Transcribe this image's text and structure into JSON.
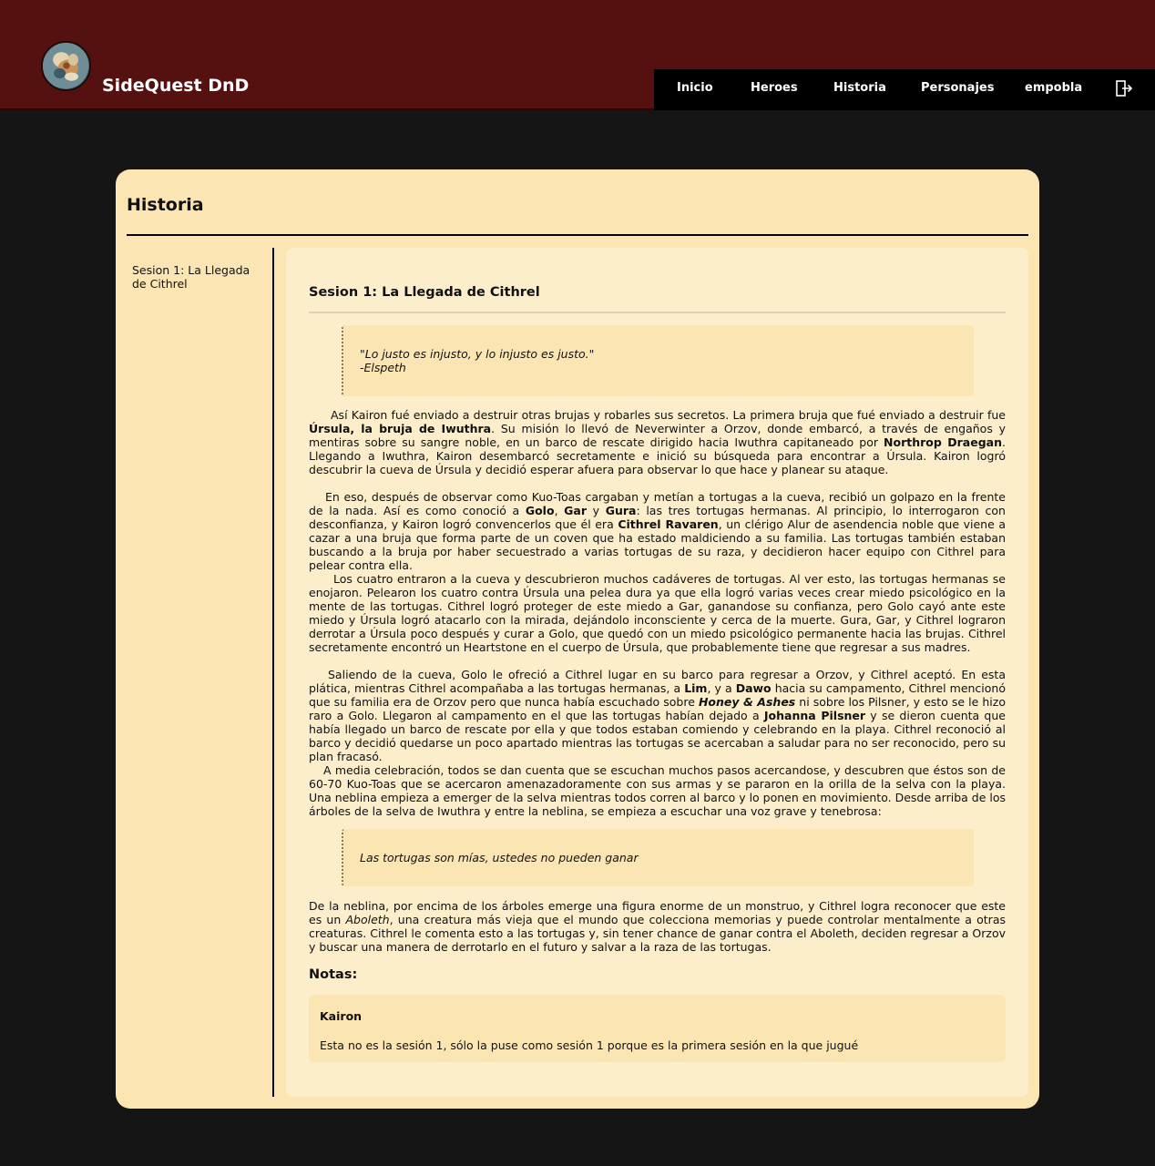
{
  "header": {
    "brand": "SideQuest DnD",
    "bg_color": "#551010",
    "nav": [
      {
        "label": "Inicio"
      },
      {
        "label": "Heroes"
      },
      {
        "label": "Historia"
      },
      {
        "label": "Personajes"
      },
      {
        "label": "empobla"
      }
    ],
    "logout_icon": "logout-icon"
  },
  "page": {
    "title": "Historia",
    "card_color": "#fbe6b3"
  },
  "sidebar": {
    "items": [
      {
        "label": "Sesion 1: La Llegada de Cithrel"
      }
    ]
  },
  "session": {
    "title": "Sesion 1: La Llegada de Cithrel",
    "quote1": {
      "line1": "\"Lo justo es injusto, y lo injusto es justo.\"",
      "line2": "-Elspeth"
    },
    "p1": {
      "a": "Así Kairon fué enviado a destruir otras brujas y robarles sus secretos. La primera bruja que fué enviado a destruir fue ",
      "b": "Úrsula, la bruja de Iwuthra",
      "c": ". Su misión lo llevó de Neverwinter a Orzov, donde embarcó, a través de engaños y mentiras sobre su sangre noble, en un barco de rescate dirigido hacia Iwuthra capitaneado por ",
      "d": "Northrop Draegan",
      "e": ". Llegando a Iwuthra, Kairon desembarcó secretamente e inició su búsqueda para encontrar a Úrsula. Kairon logró descubrir la cueva de Úrsula y decidió esperar afuera para observar lo que hace y planear su ataque."
    },
    "p2": {
      "a": "En eso, después de observar como Kuo-Toas cargaban y metían a tortugas a la cueva, recibió un golpazo en la frente de la nada. Así es como conoció a ",
      "b": "Golo",
      "c": ", ",
      "d": "Gar",
      "e": " y ",
      "f": "Gura",
      "g": ": las tres tortugas hermanas. Al principio, lo interrogaron con desconfianza, y Kairon logró convencerlos que él era ",
      "h": "Cithrel Ravaren",
      "i": ", un clérigo Alur de asendencia noble que viene a cazar a una bruja que forma parte de un coven que ha estado maldiciendo a su familia. Las tortugas también estaban buscando a la bruja por haber secuestrado a varias tortugas de su raza, y decidieron hacer equipo con Cithrel para pelear contra ella."
    },
    "p3": "Los cuatro entraron a la cueva y descubrieron muchos cadáveres de tortugas. Al ver esto, las tortugas hermanas se enojaron. Pelearon los cuatro contra Úrsula una pelea dura ya que ella logró varias veces crear miedo psicológico en la mente de las tortugas. Cithrel logró proteger de este miedo a Gar, ganandose su confianza, pero Golo cayó ante este miedo y Úrsula logró atacarlo con la mirada, dejándolo inconsciente y cerca de la muerte. Gura, Gar, y Cithrel lograron derrotar a Úrsula poco después y curar a Golo, que quedó con un miedo psicológico permanente hacia las brujas. Cithrel secretamente encontró un Heartstone en el cuerpo de Úrsula, que probablemente tiene que regresar a sus madres.",
    "p4": {
      "a": "Saliendo de la cueva, Golo le ofreció a Cithrel lugar en su barco para regresar a Orzov, y Cithrel aceptó. En esta plática, mientras Cithrel acompañaba a las tortugas hermanas, a ",
      "b": "Lim",
      "c": ", y a ",
      "d": "Dawo",
      "e": " hacia su campamento, Cithrel mencionó que su familia era de Orzov pero que nunca había escuchado sobre ",
      "f": "Honey & Ashes",
      "g": " ni sobre los Pilsner, y esto se le hizo raro a Golo. Llegaron al campamento en el que las tortugas habían dejado a ",
      "h": "Johanna Pilsner",
      "i": " y se dieron cuenta que había llegado un barco de rescate por ella y que todos estaban comiendo y celebrando en la playa. Cithrel reconoció al barco y decidió quedarse un poco apartado mientras las tortugas se acercaban a saludar para no ser reconocido, pero su plan fracasó."
    },
    "p5": "A media celebración, todos se dan cuenta que se escuchan muchos pasos acercandose, y descubren que éstos son de 60-70 Kuo-Toas que se acercaron amenazadoramente con sus armas y se pararon en la orilla de la selva con la playa. Una neblina empieza a emerger de la selva mientras todos corren al barco y lo ponen en movimiento. Desde arriba de los árboles de la selva de Iwuthra y entre la neblina, se empieza a escuchar una voz grave y tenebrosa:",
    "quote2": "Las tortugas son mías, ustedes no pueden ganar",
    "p6": {
      "a": "De la neblina, por encima de los árboles emerge una figura enorme de un monstruo, y Cithrel logra reconocer que este es un ",
      "b": "Aboleth",
      "c": ", una creatura más vieja que el mundo que colecciona memorias y puede controlar mentalmente a otras creaturas. Cithrel le comenta esto a las tortugas y, sin tener chance de ganar contra el Aboleth, deciden regresar a Orzov y buscar una manera de derrotarlo en el futuro y salvar a la raza de las tortugas."
    }
  },
  "notes": {
    "title": "Notas:",
    "items": [
      {
        "author": "Kairon",
        "text": "Esta no es la sesión 1, sólo la puse como sesión 1 porque es la primera sesión en la que jugué"
      }
    ]
  }
}
